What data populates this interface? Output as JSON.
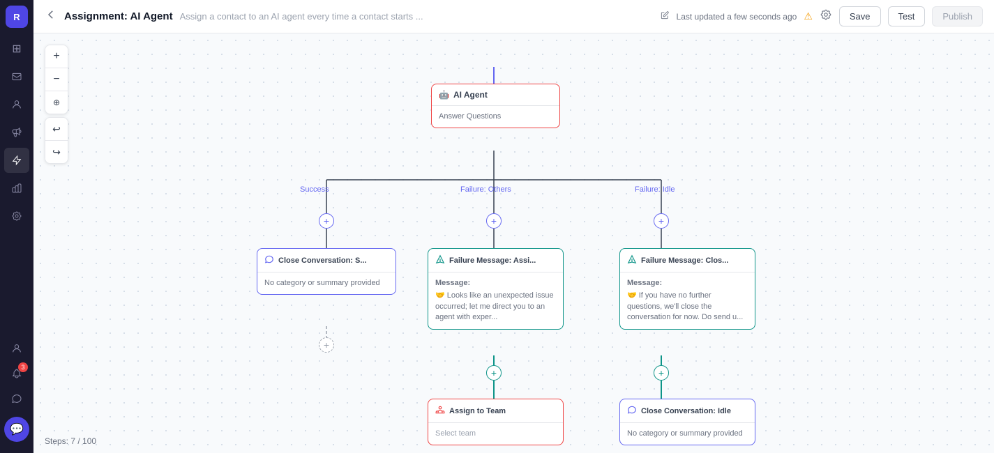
{
  "sidebar": {
    "logo": "R",
    "items": [
      {
        "name": "grid-icon",
        "icon": "⊞",
        "active": false
      },
      {
        "name": "inbox-icon",
        "icon": "📥",
        "active": false
      },
      {
        "name": "contacts-icon",
        "icon": "👤",
        "active": false
      },
      {
        "name": "megaphone-icon",
        "icon": "📣",
        "active": false
      },
      {
        "name": "automation-icon",
        "icon": "🔀",
        "active": true
      },
      {
        "name": "reports-icon",
        "icon": "📊",
        "active": false
      },
      {
        "name": "settings-icon",
        "icon": "⚙",
        "active": false
      }
    ],
    "bottom_items": [
      {
        "name": "agent-icon",
        "icon": "👤",
        "badge": null
      },
      {
        "name": "notifications-icon",
        "icon": "🔔",
        "badge": "3"
      },
      {
        "name": "help-icon",
        "icon": "💬",
        "badge": null
      }
    ],
    "chat_btn": "💬"
  },
  "topbar": {
    "title": "Assignment: AI Agent",
    "description": "Assign a contact to an AI agent every time a contact starts ...",
    "status": "Last updated a few seconds ago",
    "save_label": "Save",
    "test_label": "Test",
    "publish_label": "Publish"
  },
  "canvas": {
    "zoom_plus": "+",
    "zoom_minus": "−",
    "zoom_target": "⊕",
    "undo": "↩",
    "redo": "↪",
    "steps": "Steps: 7 / 100"
  },
  "nodes": {
    "ai_agent": {
      "title": "AI Agent",
      "subtitle": "Answer Questions",
      "icon": "🤖"
    },
    "close_success": {
      "title": "Close Conversation: S...",
      "body": "No category or summary provided",
      "icon": "💬"
    },
    "failure_message_1": {
      "title": "Failure Message: Assi...",
      "body_label": "Message:",
      "body_text": "🤝 Looks like an unexpected issue occurred; let me direct you to an agent with exper...",
      "icon": "✉"
    },
    "failure_message_2": {
      "title": "Failure Message: Clos...",
      "body_label": "Message:",
      "body_text": "🤝 If you have no further questions, we'll close the conversation for now. Do send u...",
      "icon": "✉"
    },
    "assign_team": {
      "title": "Assign to Team",
      "body": "Select team",
      "icon": "👥"
    },
    "close_idle": {
      "title": "Close Conversation: Idle",
      "body": "No category or summary provided",
      "icon": "💬"
    }
  },
  "connector_labels": {
    "success": "Success",
    "failure_others": "Failure: Others",
    "failure_idle": "Failure: Idle"
  }
}
